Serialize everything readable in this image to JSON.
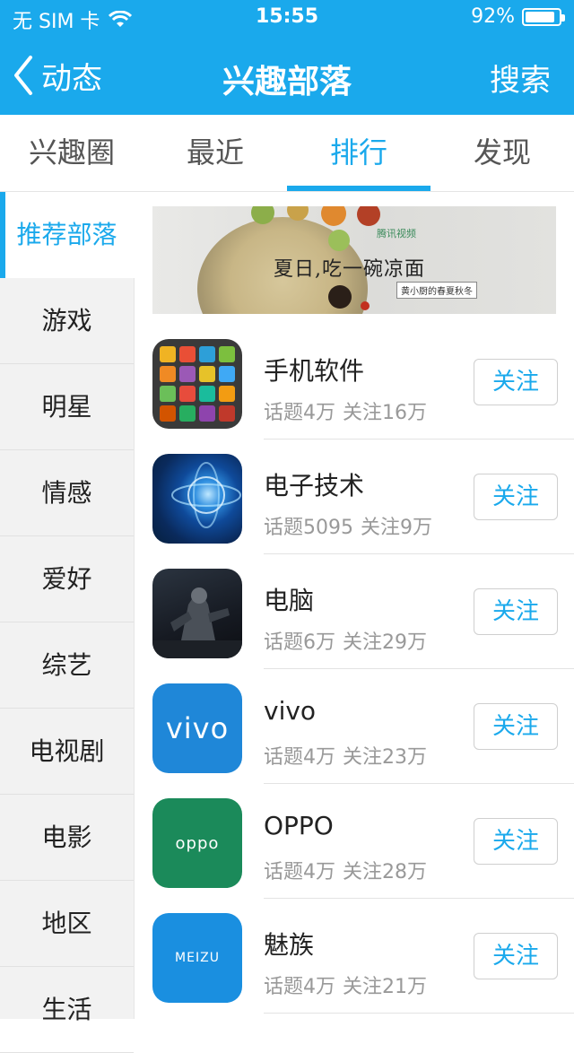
{
  "status_bar": {
    "carrier": "无 SIM 卡",
    "time": "15:55",
    "battery": "92%",
    "battery_level": 0.92
  },
  "nav": {
    "back_label": "动态",
    "title": "兴趣部落",
    "search_label": "搜索"
  },
  "tabs": [
    {
      "label": "兴趣圈"
    },
    {
      "label": "最近"
    },
    {
      "label": "排行",
      "active": true
    },
    {
      "label": "发现"
    }
  ],
  "sidebar": {
    "items": [
      {
        "label": "推荐部落",
        "active": true
      },
      {
        "label": "游戏"
      },
      {
        "label": "明星"
      },
      {
        "label": "情感"
      },
      {
        "label": "爱好"
      },
      {
        "label": "综艺"
      },
      {
        "label": "电视剧"
      },
      {
        "label": "电影"
      },
      {
        "label": "地区"
      },
      {
        "label": "生活"
      }
    ]
  },
  "banner": {
    "headline": "夏日,吃一碗凉面",
    "brand": "腾讯视频",
    "tag": "黄小厨的春夏秋冬"
  },
  "tribes": [
    {
      "name": "手机软件",
      "topics": "话题4万",
      "followers": "关注16万",
      "follow_label": "关注",
      "icon": "apps-grid-icon"
    },
    {
      "name": "电子技术",
      "topics": "话题5095",
      "followers": "关注9万",
      "follow_label": "关注",
      "icon": "tech-globe-icon"
    },
    {
      "name": "电脑",
      "topics": "话题6万",
      "followers": "关注29万",
      "follow_label": "关注",
      "icon": "computer-robot-icon"
    },
    {
      "name": "vivo",
      "topics": "话题4万",
      "followers": "关注23万",
      "follow_label": "关注",
      "icon": "vivo-logo",
      "logo_text": "vivo"
    },
    {
      "name": "OPPO",
      "topics": "话题4万",
      "followers": "关注28万",
      "follow_label": "关注",
      "icon": "oppo-logo",
      "logo_text": "oppo"
    },
    {
      "name": "魅族",
      "topics": "话题4万",
      "followers": "关注21万",
      "follow_label": "关注",
      "icon": "meizu-logo",
      "logo_text": "MEIZU"
    }
  ],
  "colors": {
    "accent": "#1aa9ec",
    "sidebar_bg": "#f2f2f2",
    "meta_text": "#999999"
  }
}
